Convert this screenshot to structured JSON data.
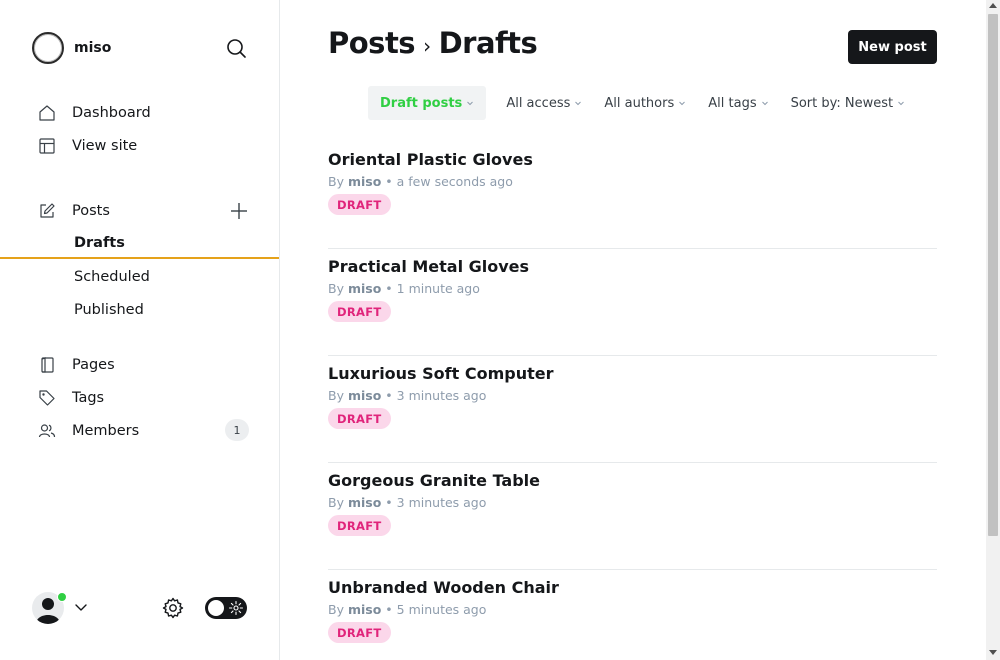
{
  "brand": {
    "name": "miso"
  },
  "sidebar": {
    "nav": [
      {
        "label": "Dashboard",
        "icon": "home-icon"
      },
      {
        "label": "View site",
        "icon": "layout-icon"
      }
    ],
    "posts": {
      "label": "Posts",
      "icon": "edit-icon"
    },
    "post_subitems": [
      {
        "label": "Drafts",
        "active": true
      },
      {
        "label": "Scheduled",
        "active": false
      },
      {
        "label": "Published",
        "active": false
      }
    ],
    "secondary": [
      {
        "label": "Pages",
        "icon": "page-icon"
      },
      {
        "label": "Tags",
        "icon": "tag-icon"
      },
      {
        "label": "Members",
        "icon": "members-icon",
        "count": "1"
      }
    ]
  },
  "header": {
    "crumb_parent": "Posts",
    "crumb_separator": "›",
    "crumb_current": "Drafts",
    "new_post_label": "New post"
  },
  "filters": [
    "Draft posts",
    "All access",
    "All authors",
    "All tags",
    "Sort by: Newest"
  ],
  "posts": [
    {
      "title": "Oriental Plastic Gloves",
      "by": "By",
      "author": "miso",
      "time": "• a few seconds ago",
      "status": "DRAFT"
    },
    {
      "title": "Practical Metal Gloves",
      "by": "By",
      "author": "miso",
      "time": "• 1 minute ago",
      "status": "DRAFT"
    },
    {
      "title": "Luxurious Soft Computer",
      "by": "By",
      "author": "miso",
      "time": "• 3 minutes ago",
      "status": "DRAFT"
    },
    {
      "title": "Gorgeous Granite Table",
      "by": "By",
      "author": "miso",
      "time": "• 3 minutes ago",
      "status": "DRAFT"
    },
    {
      "title": "Unbranded Wooden Chair",
      "by": "By",
      "author": "miso",
      "time": "• 5 minutes ago",
      "status": "DRAFT"
    }
  ],
  "colors": {
    "accent_green": "#30cf43",
    "draft_pink": "#e0247b",
    "active_underline": "#e5a21a"
  }
}
